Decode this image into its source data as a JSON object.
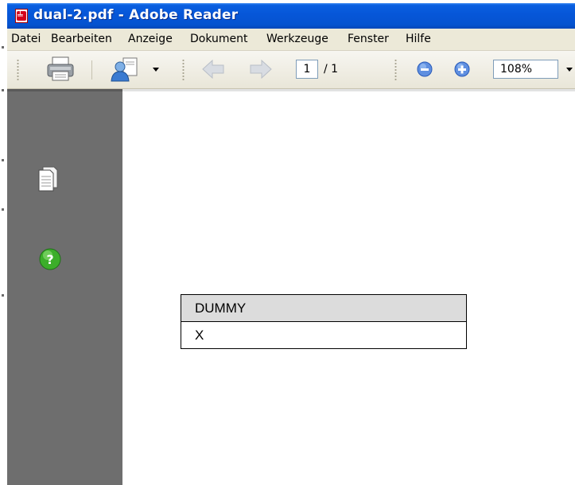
{
  "window": {
    "title": "dual-2.pdf - Adobe Reader",
    "title_color": "#0656d8"
  },
  "menu": [
    "Datei",
    "Bearbeiten",
    "Anzeige",
    "Dokument",
    "Werkzeuge",
    "Fenster",
    "Hilfe"
  ],
  "toolbar": {
    "icons": [
      "print-icon",
      "share-icon",
      "previous-page-icon",
      "next-page-icon",
      "zoom-out-icon",
      "zoom-in-icon"
    ],
    "page_number": "1",
    "page_total": "/ 1",
    "zoom": "108%"
  },
  "nav_pane": {
    "icons": [
      "pages-icon",
      "help-icon"
    ],
    "help_glyph": "?",
    "background": "#6e6e6e"
  },
  "document": {
    "table": {
      "header": "DUMMY",
      "rows": [
        "X"
      ]
    }
  }
}
